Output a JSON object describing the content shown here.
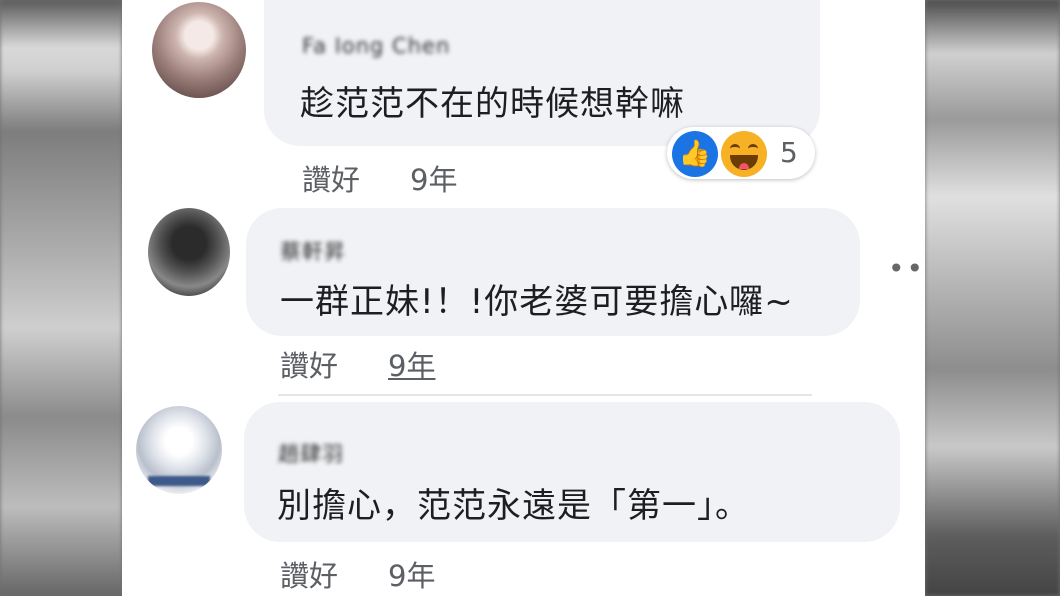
{
  "comments": [
    {
      "author": "Fa Iong Chen",
      "text": "趁范范不在的時候想幹嘛",
      "like_label": "讚好",
      "time": "9年",
      "reactions": {
        "icons": [
          "like-icon",
          "haha-icon"
        ],
        "count": "5"
      }
    },
    {
      "author": "蔡軒昇",
      "text": "一群正妹!！!你老婆可要擔心囉~",
      "like_label": "讚好",
      "time": "9年"
    },
    {
      "author": "趙肆羽",
      "text": "別擔心，范范永遠是「第一」。",
      "like_label": "讚好",
      "time": "9年"
    }
  ],
  "more_menu": "•••",
  "colors": {
    "bubble": "#f0f2f5",
    "like_blue": "#1b74e4",
    "haha_yellow": "#f7b125"
  }
}
